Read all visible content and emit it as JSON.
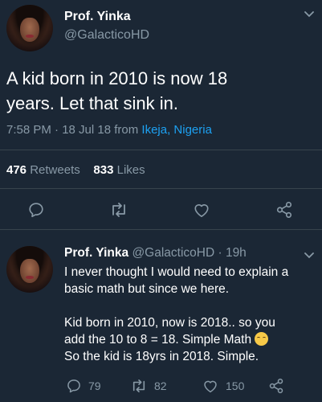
{
  "main_tweet": {
    "display_name": "Prof. Yinka",
    "handle": "@GalacticoHD",
    "text_line1": "A kid born in 2010 is now 18",
    "text_line2": "years. Let that sink in.",
    "timestamp": "7:58 PM · 18 Jul 18 from ",
    "location": "Ikeja, Nigeria",
    "retweets_count": "476",
    "retweets_label": "Retweets",
    "likes_count": "833",
    "likes_label": "Likes"
  },
  "reply": {
    "display_name": "Prof. Yinka",
    "handle_time": "@GalacticoHD · 19h",
    "line1": "I never thought I would need to explain a",
    "line2": "basic math but since we here.",
    "line3": "Kid born in 2010, now is 2018.. so you",
    "line4": "add the 10 to 8 = 18. Simple Math",
    "line5": "So the kid is 18yrs in 2018. Simple.",
    "reply_count": "79",
    "retweet_count": "82",
    "like_count": "150"
  },
  "icons": {
    "chevron": "chevron-down-icon",
    "reply": "reply-icon",
    "retweet": "retweet-icon",
    "like": "heart-icon",
    "share": "share-icon",
    "emoji": "relieved-face-emoji"
  },
  "colors": {
    "background": "#1b2735",
    "secondary_text": "#8899a6",
    "link": "#1da1f2",
    "divider": "#38444d"
  }
}
